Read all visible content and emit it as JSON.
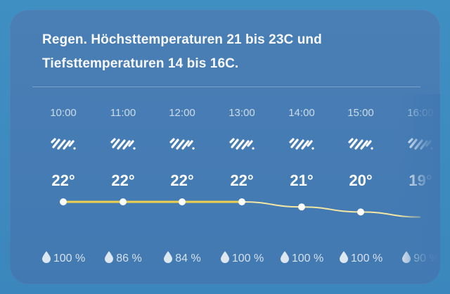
{
  "summary": {
    "line1": "Regen. Höchsttemperaturen 21 bis 23C und",
    "line2": "Tiefsttemperaturen 14 bis 16C."
  },
  "hourly": [
    {
      "time": "10:00",
      "icon": "rain-icon",
      "temp": "22°",
      "temp_value": 22,
      "precip": "100 %"
    },
    {
      "time": "11:00",
      "icon": "rain-icon",
      "temp": "22°",
      "temp_value": 22,
      "precip": "86 %"
    },
    {
      "time": "12:00",
      "icon": "rain-icon",
      "temp": "22°",
      "temp_value": 22,
      "precip": "84 %"
    },
    {
      "time": "13:00",
      "icon": "rain-icon",
      "temp": "22°",
      "temp_value": 22,
      "precip": "100 %"
    },
    {
      "time": "14:00",
      "icon": "rain-icon",
      "temp": "21°",
      "temp_value": 21,
      "precip": "100 %"
    },
    {
      "time": "15:00",
      "icon": "rain-icon",
      "temp": "20°",
      "temp_value": 20,
      "precip": "100 %"
    },
    {
      "time": "16:00",
      "icon": "rain-icon",
      "temp": "19°",
      "temp_value": 19,
      "precip": "90 %"
    }
  ],
  "colors": {
    "line_past": "#f0d24a",
    "line_future": "#f4e7a2",
    "point": "#ffffff"
  }
}
